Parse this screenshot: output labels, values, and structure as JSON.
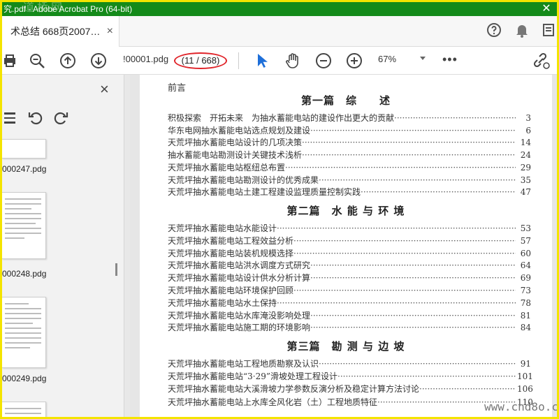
{
  "window": {
    "title": "究.pdf - Adobe Acrobat Pro (64-bit)",
    "watermark_top": "道桥网",
    "close_symbol": "✕"
  },
  "tab": {
    "label": "术总结 668页2007…",
    "close_symbol": "×"
  },
  "toolbar": {
    "page_field": "!00001.pdg",
    "page_count": "(11 / 668)",
    "zoom": "67%",
    "more": "•••"
  },
  "icons": [
    "print-icon",
    "zoom-out-magnifier-icon",
    "previous-page-icon",
    "next-page-icon",
    "select-cursor-icon",
    "hand-tool-icon",
    "zoom-out-icon",
    "zoom-in-icon",
    "share-link-icon",
    "help-icon",
    "bell-icon",
    "user-icon",
    "close-panel-icon",
    "extract-icon",
    "rotate-left-icon",
    "rotate-right-icon",
    "collapse-panel-icon"
  ],
  "sidebar": {
    "close_symbol": "×",
    "thumbnails": [
      {
        "label": "000247.pdg"
      },
      {
        "label": "000248.pdg"
      },
      {
        "label": "000249.pdg"
      }
    ]
  },
  "document": {
    "preface": "前言",
    "sections": [
      {
        "title": "第一篇　综　　述",
        "entries": [
          {
            "text": "积极探索　开拓未来　为抽水蓄能电站的建设作出更大的贡献",
            "page": "3"
          },
          {
            "text": "华东电网抽水蓄能电站选点规划及建设",
            "page": "6"
          },
          {
            "text": "天荒坪抽水蓄能电站设计的几项决策",
            "page": "14"
          },
          {
            "text": "抽水蓄能电站勘测设计关键技术浅析",
            "page": "24"
          },
          {
            "text": "天荒坪抽水蓄能电站枢纽总布置",
            "page": "29"
          },
          {
            "text": "天荒坪抽水蓄能电站勘测设计的优秀成果",
            "page": "35"
          },
          {
            "text": "天荒坪抽水蓄能电站土建工程建设监理质量控制实践",
            "page": "47"
          }
        ]
      },
      {
        "title": "第二篇　水 能 与 环 境",
        "entries": [
          {
            "text": "天荒坪抽水蓄能电站水能设计",
            "page": "53"
          },
          {
            "text": "天荒坪抽水蓄能电站工程效益分析",
            "page": "57"
          },
          {
            "text": "天荒坪抽水蓄能电站装机规模选择",
            "page": "60"
          },
          {
            "text": "天荒坪抽水蓄能电站洪水调度方式研究",
            "page": "64"
          },
          {
            "text": "天荒坪抽水蓄能电站设计供水分析计算",
            "page": "69"
          },
          {
            "text": "天荒坪抽水蓄能电站环境保护回顾",
            "page": "73"
          },
          {
            "text": "天荒坪抽水蓄能电站水土保持",
            "page": "78"
          },
          {
            "text": "天荒坪抽水蓄能电站水库淹没影响处理",
            "page": "81"
          },
          {
            "text": "天荒坪抽水蓄能电站施工期的环境影响",
            "page": "84"
          }
        ]
      },
      {
        "title": "第三篇　勘 测 与 边 坡",
        "entries": [
          {
            "text": "天荒坪抽水蓄能电站工程地质勘察及认识",
            "page": "91"
          },
          {
            "text": "天荒坪抽水蓄能电站“3·29”滑坡处理工程设计",
            "page": "101"
          },
          {
            "text": "天荒坪抽水蓄能电站大溪滑坡力学参数反演分析及稳定计算方法讨论",
            "page": "106"
          },
          {
            "text": "天荒坪抽水蓄能电站上水库全风化岩（土）工程地质特征",
            "page": "110"
          }
        ]
      }
    ],
    "watermark_bottom": "www.cnd8o.com"
  }
}
